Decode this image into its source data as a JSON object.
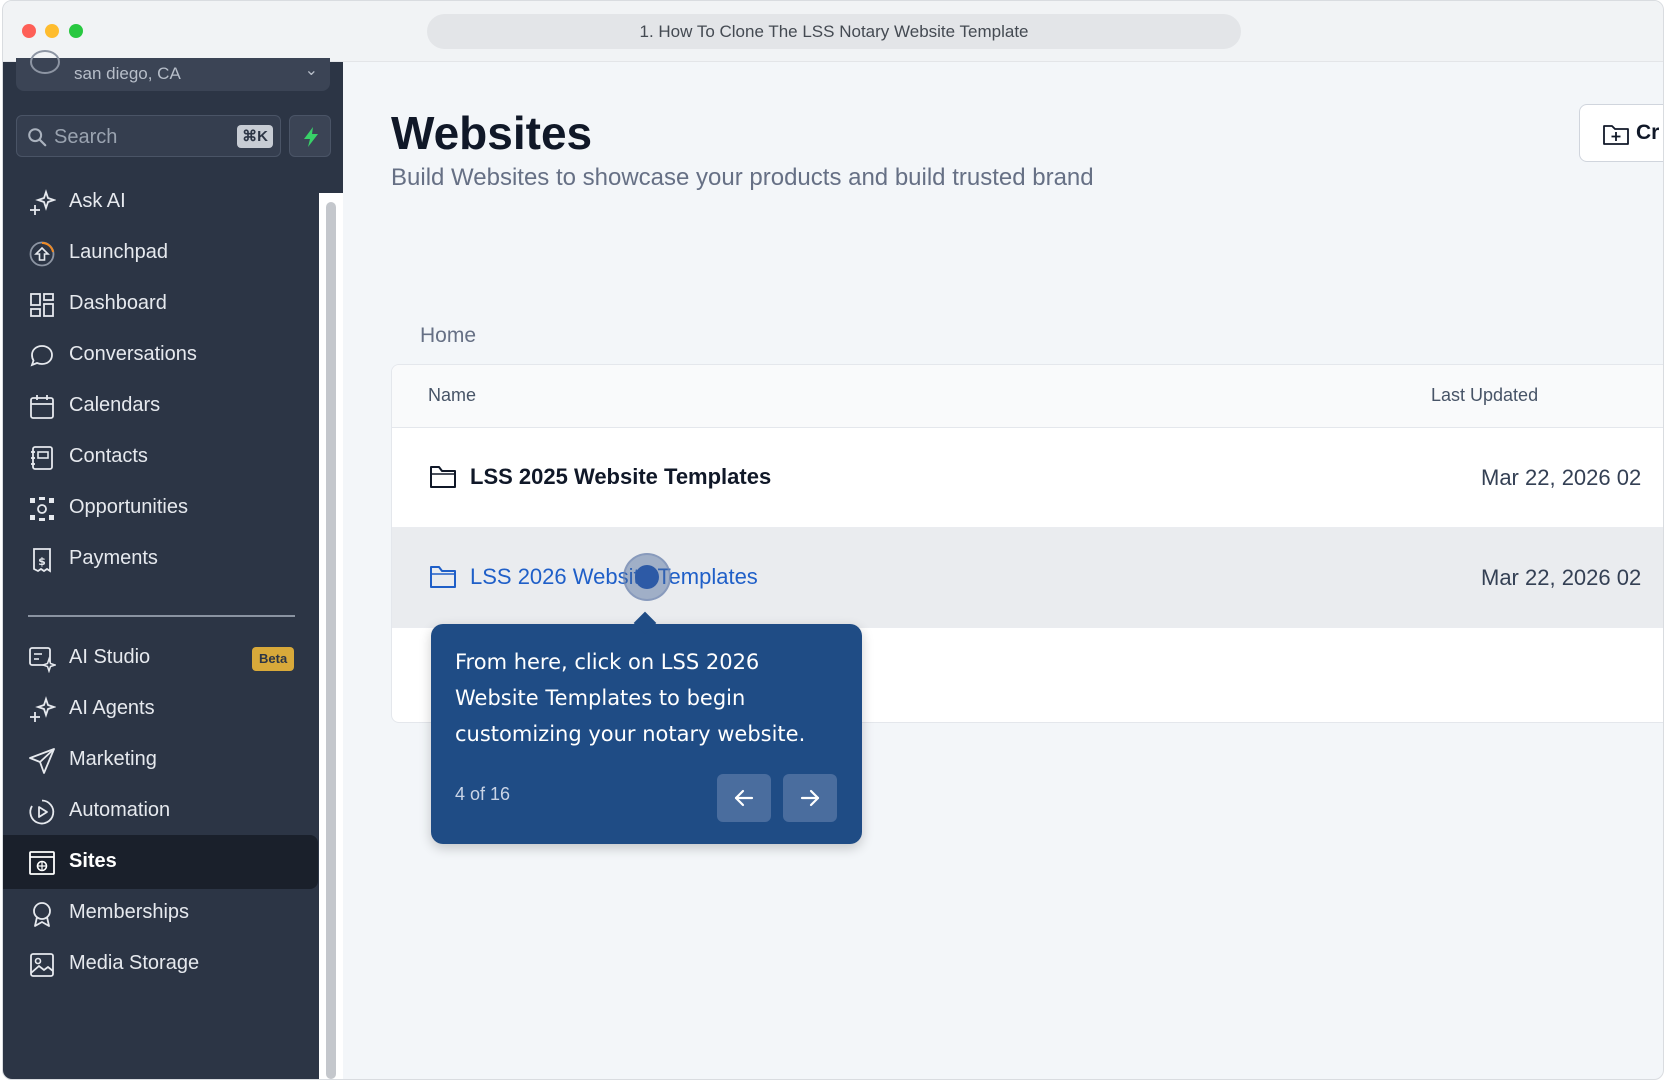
{
  "window": {
    "tab_title": "1. How To Clone The LSS Notary Website Template"
  },
  "sidebar": {
    "location": "san diego, CA",
    "search_placeholder": "Search",
    "search_shortcut": "⌘K",
    "items": [
      {
        "label": "Ask AI",
        "icon": "sparkle-icon"
      },
      {
        "label": "Launchpad",
        "icon": "launchpad-icon"
      },
      {
        "label": "Dashboard",
        "icon": "dashboard-icon"
      },
      {
        "label": "Conversations",
        "icon": "chat-icon"
      },
      {
        "label": "Calendars",
        "icon": "calendar-icon"
      },
      {
        "label": "Contacts",
        "icon": "contacts-icon"
      },
      {
        "label": "Opportunities",
        "icon": "opportunities-icon"
      },
      {
        "label": "Payments",
        "icon": "payments-icon"
      },
      {
        "label": "AI Studio",
        "icon": "ai-studio-icon",
        "badge": "Beta"
      },
      {
        "label": "AI Agents",
        "icon": "sparkle-icon"
      },
      {
        "label": "Marketing",
        "icon": "send-icon"
      },
      {
        "label": "Automation",
        "icon": "automation-icon"
      },
      {
        "label": "Sites",
        "icon": "sites-icon",
        "active": true
      },
      {
        "label": "Memberships",
        "icon": "award-icon"
      },
      {
        "label": "Media Storage",
        "icon": "image-icon"
      }
    ]
  },
  "main": {
    "title": "Websites",
    "subtitle": "Build Websites to showcase your products and build trusted brand",
    "create_label": "Cr",
    "breadcrumb": "Home",
    "columns": {
      "name": "Name",
      "updated": "Last Updated"
    },
    "rows": [
      {
        "name": "LSS 2025 Website Templates",
        "updated": "Mar 22, 2026 02"
      },
      {
        "name": "LSS 2026 Website Templates",
        "updated": "Mar 22, 2026 02"
      }
    ]
  },
  "tooltip": {
    "text": "From here, click on LSS 2026 Website Templates to begin customizing your notary website.",
    "step": "4 of 16"
  },
  "colors": {
    "sidebar_bg": "#2c3545",
    "tooltip_bg": "#1f4c85",
    "link_blue": "#1f5fc8",
    "beta_badge": "#d8a93a"
  }
}
